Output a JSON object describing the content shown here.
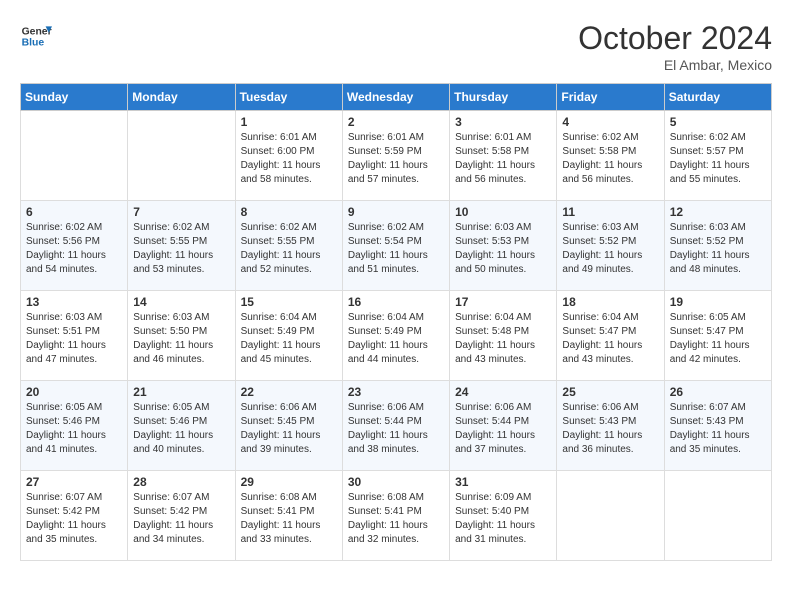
{
  "logo": {
    "line1": "General",
    "line2": "Blue"
  },
  "title": "October 2024",
  "location": "El Ambar, Mexico",
  "weekdays": [
    "Sunday",
    "Monday",
    "Tuesday",
    "Wednesday",
    "Thursday",
    "Friday",
    "Saturday"
  ],
  "weeks": [
    [
      {
        "day": "",
        "info": ""
      },
      {
        "day": "",
        "info": ""
      },
      {
        "day": "1",
        "info": "Sunrise: 6:01 AM\nSunset: 6:00 PM\nDaylight: 11 hours and 58 minutes."
      },
      {
        "day": "2",
        "info": "Sunrise: 6:01 AM\nSunset: 5:59 PM\nDaylight: 11 hours and 57 minutes."
      },
      {
        "day": "3",
        "info": "Sunrise: 6:01 AM\nSunset: 5:58 PM\nDaylight: 11 hours and 56 minutes."
      },
      {
        "day": "4",
        "info": "Sunrise: 6:02 AM\nSunset: 5:58 PM\nDaylight: 11 hours and 56 minutes."
      },
      {
        "day": "5",
        "info": "Sunrise: 6:02 AM\nSunset: 5:57 PM\nDaylight: 11 hours and 55 minutes."
      }
    ],
    [
      {
        "day": "6",
        "info": "Sunrise: 6:02 AM\nSunset: 5:56 PM\nDaylight: 11 hours and 54 minutes."
      },
      {
        "day": "7",
        "info": "Sunrise: 6:02 AM\nSunset: 5:55 PM\nDaylight: 11 hours and 53 minutes."
      },
      {
        "day": "8",
        "info": "Sunrise: 6:02 AM\nSunset: 5:55 PM\nDaylight: 11 hours and 52 minutes."
      },
      {
        "day": "9",
        "info": "Sunrise: 6:02 AM\nSunset: 5:54 PM\nDaylight: 11 hours and 51 minutes."
      },
      {
        "day": "10",
        "info": "Sunrise: 6:03 AM\nSunset: 5:53 PM\nDaylight: 11 hours and 50 minutes."
      },
      {
        "day": "11",
        "info": "Sunrise: 6:03 AM\nSunset: 5:52 PM\nDaylight: 11 hours and 49 minutes."
      },
      {
        "day": "12",
        "info": "Sunrise: 6:03 AM\nSunset: 5:52 PM\nDaylight: 11 hours and 48 minutes."
      }
    ],
    [
      {
        "day": "13",
        "info": "Sunrise: 6:03 AM\nSunset: 5:51 PM\nDaylight: 11 hours and 47 minutes."
      },
      {
        "day": "14",
        "info": "Sunrise: 6:03 AM\nSunset: 5:50 PM\nDaylight: 11 hours and 46 minutes."
      },
      {
        "day": "15",
        "info": "Sunrise: 6:04 AM\nSunset: 5:49 PM\nDaylight: 11 hours and 45 minutes."
      },
      {
        "day": "16",
        "info": "Sunrise: 6:04 AM\nSunset: 5:49 PM\nDaylight: 11 hours and 44 minutes."
      },
      {
        "day": "17",
        "info": "Sunrise: 6:04 AM\nSunset: 5:48 PM\nDaylight: 11 hours and 43 minutes."
      },
      {
        "day": "18",
        "info": "Sunrise: 6:04 AM\nSunset: 5:47 PM\nDaylight: 11 hours and 43 minutes."
      },
      {
        "day": "19",
        "info": "Sunrise: 6:05 AM\nSunset: 5:47 PM\nDaylight: 11 hours and 42 minutes."
      }
    ],
    [
      {
        "day": "20",
        "info": "Sunrise: 6:05 AM\nSunset: 5:46 PM\nDaylight: 11 hours and 41 minutes."
      },
      {
        "day": "21",
        "info": "Sunrise: 6:05 AM\nSunset: 5:46 PM\nDaylight: 11 hours and 40 minutes."
      },
      {
        "day": "22",
        "info": "Sunrise: 6:06 AM\nSunset: 5:45 PM\nDaylight: 11 hours and 39 minutes."
      },
      {
        "day": "23",
        "info": "Sunrise: 6:06 AM\nSunset: 5:44 PM\nDaylight: 11 hours and 38 minutes."
      },
      {
        "day": "24",
        "info": "Sunrise: 6:06 AM\nSunset: 5:44 PM\nDaylight: 11 hours and 37 minutes."
      },
      {
        "day": "25",
        "info": "Sunrise: 6:06 AM\nSunset: 5:43 PM\nDaylight: 11 hours and 36 minutes."
      },
      {
        "day": "26",
        "info": "Sunrise: 6:07 AM\nSunset: 5:43 PM\nDaylight: 11 hours and 35 minutes."
      }
    ],
    [
      {
        "day": "27",
        "info": "Sunrise: 6:07 AM\nSunset: 5:42 PM\nDaylight: 11 hours and 35 minutes."
      },
      {
        "day": "28",
        "info": "Sunrise: 6:07 AM\nSunset: 5:42 PM\nDaylight: 11 hours and 34 minutes."
      },
      {
        "day": "29",
        "info": "Sunrise: 6:08 AM\nSunset: 5:41 PM\nDaylight: 11 hours and 33 minutes."
      },
      {
        "day": "30",
        "info": "Sunrise: 6:08 AM\nSunset: 5:41 PM\nDaylight: 11 hours and 32 minutes."
      },
      {
        "day": "31",
        "info": "Sunrise: 6:09 AM\nSunset: 5:40 PM\nDaylight: 11 hours and 31 minutes."
      },
      {
        "day": "",
        "info": ""
      },
      {
        "day": "",
        "info": ""
      }
    ]
  ]
}
